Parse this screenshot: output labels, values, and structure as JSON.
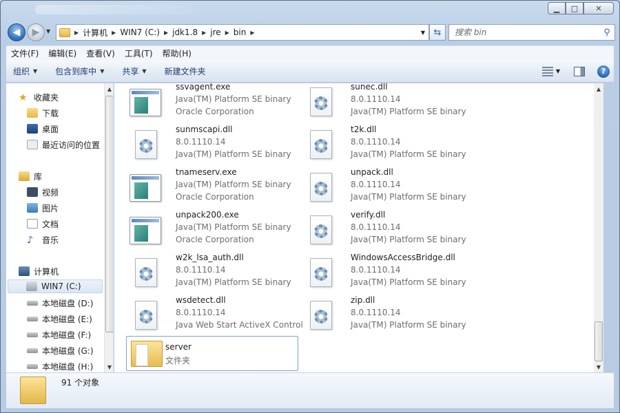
{
  "window": {
    "minimize": "▁",
    "maximize": "□",
    "close": "✕"
  },
  "address": {
    "breadcrumbs": [
      "计算机",
      "WIN7 (C:)",
      "jdk1.8",
      "jre",
      "bin"
    ],
    "search_placeholder": "搜索 bin"
  },
  "menu": [
    "文件(F)",
    "编辑(E)",
    "查看(V)",
    "工具(T)",
    "帮助(H)"
  ],
  "toolbar": {
    "organize": "组织",
    "include_library": "包含到库中",
    "share": "共享",
    "new_folder": "新建文件夹"
  },
  "nav": {
    "favorites": "收藏夹",
    "downloads": "下载",
    "desktop": "桌面",
    "recent": "最近访问的位置",
    "libraries": "库",
    "videos": "视频",
    "pictures": "图片",
    "documents": "文档",
    "music": "音乐",
    "computer": "计算机",
    "drives": [
      "WIN7 (C:)",
      "本地磁盘 (D:)",
      "本地磁盘 (E:)",
      "本地磁盘 (F:)",
      "本地磁盘 (G:)",
      "本地磁盘 (H:)"
    ]
  },
  "files": [
    {
      "name": "ssvagent.exe",
      "line2": "Java(TM) Platform SE binary",
      "line3": "Oracle Corporation",
      "type": "exe"
    },
    {
      "name": "sunec.dll",
      "line2": "8.0.1110.14",
      "line3": "Java(TM) Platform SE binary",
      "type": "dll"
    },
    {
      "name": "sunmscapi.dll",
      "line2": "8.0.1110.14",
      "line3": "Java(TM) Platform SE binary",
      "type": "dll"
    },
    {
      "name": "t2k.dll",
      "line2": "8.0.1110.14",
      "line3": "Java(TM) Platform SE binary",
      "type": "dll"
    },
    {
      "name": "tnameserv.exe",
      "line2": "Java(TM) Platform SE binary",
      "line3": "Oracle Corporation",
      "type": "exe"
    },
    {
      "name": "unpack.dll",
      "line2": "8.0.1110.14",
      "line3": "Java(TM) Platform SE binary",
      "type": "dll"
    },
    {
      "name": "unpack200.exe",
      "line2": "Java(TM) Platform SE binary",
      "line3": "Oracle Corporation",
      "type": "exe"
    },
    {
      "name": "verify.dll",
      "line2": "8.0.1110.14",
      "line3": "Java(TM) Platform SE binary",
      "type": "dll"
    },
    {
      "name": "w2k_lsa_auth.dll",
      "line2": "8.0.1110.14",
      "line3": "Java(TM) Platform SE binary",
      "type": "dll"
    },
    {
      "name": "WindowsAccessBridge.dll",
      "line2": "8.0.1110.14",
      "line3": "Java(TM) Platform SE binary",
      "type": "dll"
    },
    {
      "name": "wsdetect.dll",
      "line2": "8.0.1110.14",
      "line3": "Java Web Start ActiveX Control",
      "type": "dll"
    },
    {
      "name": "zip.dll",
      "line2": "8.0.1110.14",
      "line3": "Java(TM) Platform SE binary",
      "type": "dll"
    },
    {
      "name": "server",
      "line2": "文件夹",
      "line3": "",
      "type": "folder"
    }
  ],
  "status": {
    "count": "91 个对象"
  }
}
